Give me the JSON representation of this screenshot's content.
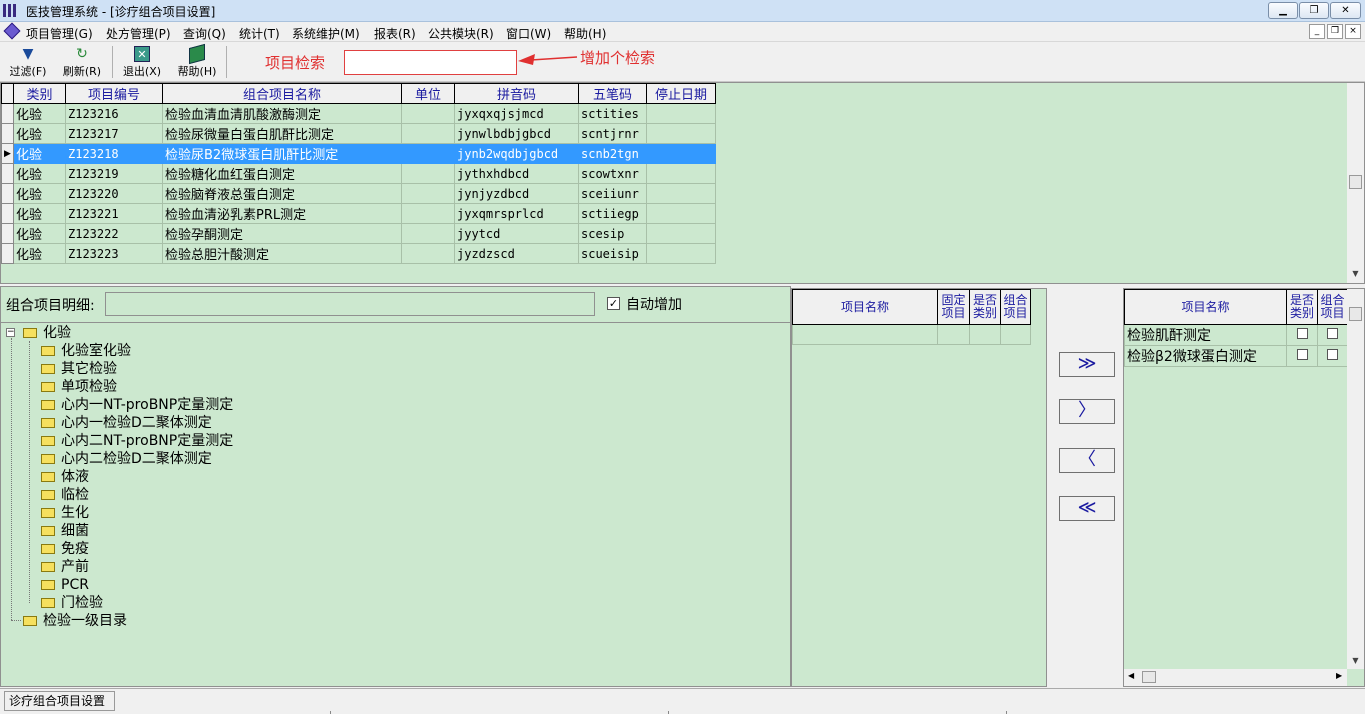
{
  "window": {
    "title": "医技管理系统 - [诊疗组合项目设置]",
    "controls": {
      "minimize": "▁",
      "restore": "❐",
      "close": "✕"
    },
    "mdi_controls": {
      "minimize": "_",
      "restore": "❐",
      "close": "×"
    }
  },
  "menu": [
    "项目管理(G)",
    "处方管理(P)",
    "查询(Q)",
    "统计(T)",
    "系统维护(M)",
    "报表(R)",
    "公共模块(R)",
    "窗口(W)",
    "帮助(H)"
  ],
  "toolbar": {
    "filter": {
      "label": "过滤(F)",
      "icon": "filter-icon"
    },
    "refresh": {
      "label": "刷新(R)",
      "icon": "refresh-icon"
    },
    "exit": {
      "label": "退出(X)",
      "icon": "exit-icon"
    },
    "help": {
      "label": "帮助(H)",
      "icon": "help-book-icon"
    }
  },
  "search": {
    "label": "项目检索",
    "value": ""
  },
  "annotation": {
    "text": "增加个检索",
    "color": "#e03030"
  },
  "grid": {
    "headers": [
      "类别",
      "项目编号",
      "组合项目名称",
      "单位",
      "拼音码",
      "五笔码",
      "停止日期"
    ],
    "rows": [
      {
        "cat": "化验",
        "code": "Z123216",
        "name": "检验血清血清肌酸激酶测定",
        "unit": "",
        "py": "jyxqxqjsjmcd",
        "wb": "sctities",
        "stop": ""
      },
      {
        "cat": "化验",
        "code": "Z123217",
        "name": "检验尿微量白蛋白肌酐比测定",
        "unit": "",
        "py": "jynwlbdbjgbcd",
        "wb": "scntjrnr",
        "stop": ""
      },
      {
        "cat": "化验",
        "code": "Z123218",
        "name": "检验尿B2微球蛋白肌酐比测定",
        "unit": "",
        "py": "jynb2wqdbjgbcd",
        "wb": "scnb2tgn",
        "stop": ""
      },
      {
        "cat": "化验",
        "code": "Z123219",
        "name": "检验糖化血红蛋白测定",
        "unit": "",
        "py": "jythxhdbcd",
        "wb": "scowtxnr",
        "stop": ""
      },
      {
        "cat": "化验",
        "code": "Z123220",
        "name": "检验脑脊液总蛋白测定",
        "unit": "",
        "py": "jynjyzdbcd",
        "wb": "sceiiunr",
        "stop": ""
      },
      {
        "cat": "化验",
        "code": "Z123221",
        "name": "检验血清泌乳素PRL测定",
        "unit": "",
        "py": "jyxqmrsprlcd",
        "wb": "sctiiegp",
        "stop": ""
      },
      {
        "cat": "化验",
        "code": "Z123222",
        "name": "检验孕酮测定",
        "unit": "",
        "py": "jyytcd",
        "wb": "scesip",
        "stop": ""
      },
      {
        "cat": "化验",
        "code": "Z123223",
        "name": "检验总胆汁酸测定",
        "unit": "",
        "py": "jyzdzscd",
        "wb": "scueisip",
        "stop": ""
      }
    ],
    "selected_row_index": 2,
    "row_pointer": "▶",
    "selection_color": "#3399ff"
  },
  "detail": {
    "label": "组合项目明细:",
    "value": "",
    "auto_add_label": "自动增加",
    "auto_add_checked": true
  },
  "tree": {
    "expander": "−",
    "root": "化验",
    "children": [
      "化验室化验",
      "其它检验",
      "单项检验",
      "心内一NT-proBNP定量测定",
      "心内一检验D二聚体测定",
      "心内二NT-proBNP定量测定",
      "心内二检验D二聚体测定",
      "体液",
      "临检",
      "生化",
      "细菌",
      "免疫",
      "产前",
      "PCR",
      "门检验"
    ],
    "sibling": "检验一级目录"
  },
  "middle_table": {
    "headers": [
      "项目名称",
      "固定项目",
      "是否类别",
      "组合项目"
    ]
  },
  "move_buttons": {
    "add_all": "≫",
    "add_one": "〉",
    "remove_one": "〈",
    "remove_all": "≪"
  },
  "right_table": {
    "headers": [
      "项目名称",
      "是否类别",
      "组合项目"
    ],
    "rows": [
      {
        "name": "检验肌酐测定",
        "is_category": false,
        "is_combo": false
      },
      {
        "name": "检验β2微球蛋白测定",
        "is_category": false,
        "is_combo": false
      }
    ]
  },
  "status": {
    "text": "诊疗组合项目设置"
  }
}
